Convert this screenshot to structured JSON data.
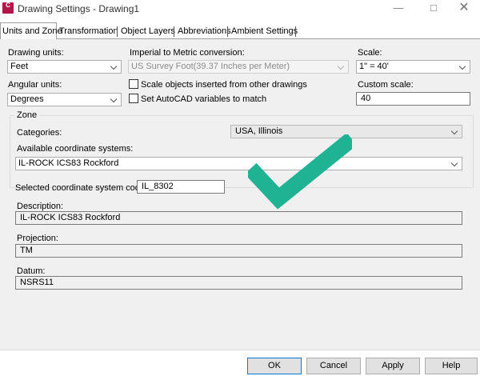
{
  "window": {
    "title": "Drawing Settings - Drawing1",
    "app_icon_text": "C"
  },
  "tabs": [
    {
      "label": "Units and Zone",
      "active": true
    },
    {
      "label": "Transformation",
      "active": false
    },
    {
      "label": "Object Layers",
      "active": false
    },
    {
      "label": "Abbreviations",
      "active": false
    },
    {
      "label": "Ambient Settings",
      "active": false
    }
  ],
  "units": {
    "drawing_units_label": "Drawing units:",
    "drawing_units_value": "Feet",
    "imperial_label": "Imperial to Metric conversion:",
    "imperial_value": "US Survey Foot(39.37 Inches per Meter)",
    "scale_label": "Scale:",
    "scale_value": "1\" = 40'",
    "angular_label": "Angular units:",
    "angular_value": "Degrees",
    "scale_objects_label": "Scale objects inserted from other drawings",
    "set_autocad_label": "Set AutoCAD variables to match",
    "custom_scale_label": "Custom scale:",
    "custom_scale_value": "40"
  },
  "zone": {
    "legend": "Zone",
    "categories_label": "Categories:",
    "categories_value": "USA, Illinois",
    "available_label": "Available coordinate systems:",
    "available_value": "IL-ROCK ICS83 Rockford",
    "selected_code_label": "Selected coordinate system code:",
    "selected_code_value": "IL_8302",
    "description_label": "Description:",
    "description_value": "IL-ROCK ICS83 Rockford",
    "projection_label": "Projection:",
    "projection_value": "TM",
    "datum_label": "Datum:",
    "datum_value": "NSRS11"
  },
  "buttons": {
    "ok": "OK",
    "cancel": "Cancel",
    "apply": "Apply",
    "help": "Help"
  },
  "colors": {
    "checkmark": "#1fb394",
    "app_icon": "#b4164a"
  }
}
